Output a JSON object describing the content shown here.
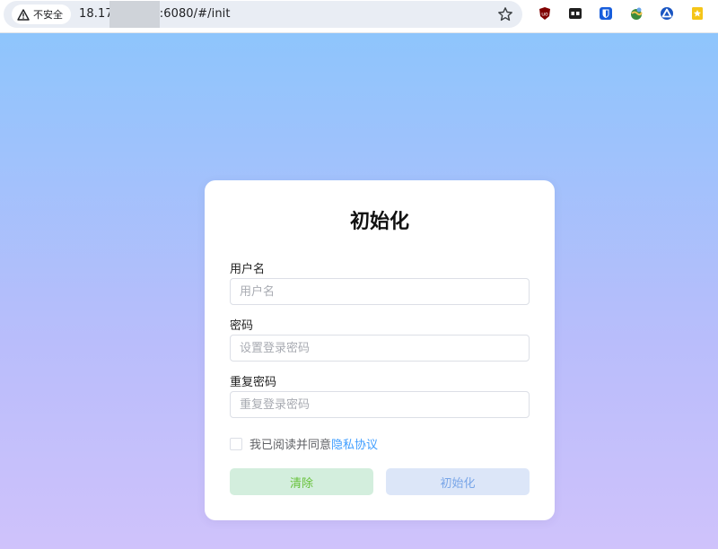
{
  "browser": {
    "security_label": "不安全",
    "url_prefix": "18.17",
    "url_suffix": ":6080/#/init"
  },
  "form": {
    "title": "初始化",
    "username": {
      "label": "用户名",
      "placeholder": "用户名",
      "value": ""
    },
    "password": {
      "label": "密码",
      "placeholder": "设置登录密码",
      "value": ""
    },
    "repeat_password": {
      "label": "重复密码",
      "placeholder": "重复登录密码",
      "value": ""
    },
    "agree_text": "我已阅读并同意",
    "agree_link": "隐私协议",
    "clear_button": "清除",
    "init_button": "初始化"
  },
  "colors": {
    "gradient_top": "#8ec5fc",
    "gradient_bottom": "#cfc2fb",
    "link": "#409eff",
    "clear_button_bg": "#d3eedd",
    "init_button_bg": "#dce6f8"
  }
}
